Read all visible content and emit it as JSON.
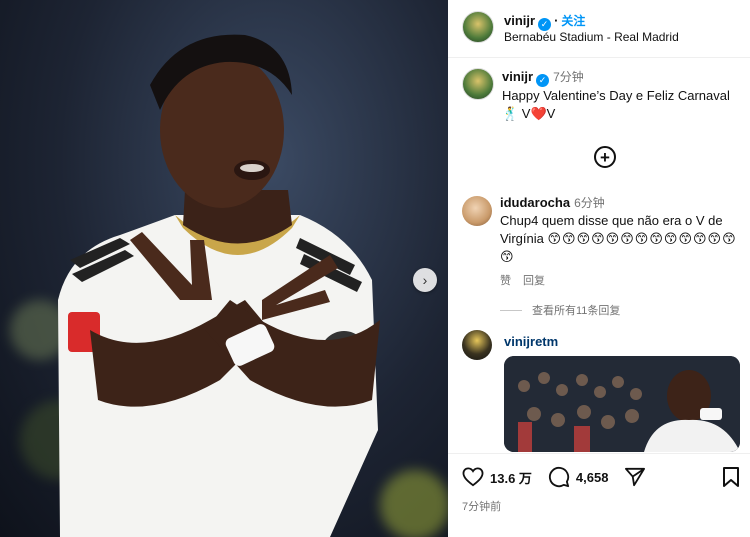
{
  "header": {
    "username": "vinijr",
    "follow_label": "关注",
    "location": "Bernabéu Stadium - Real Madrid"
  },
  "caption": {
    "username": "vinijr",
    "time": "7分钟",
    "text": "Happy Valentine’s Day e Feliz Carnaval 🕺 V❤️V"
  },
  "comment": {
    "username": "idudarocha",
    "time": "6分钟",
    "text": "Chup4 quem disse que não era o V de Virgínia",
    "emojis": "😙😙😙😙😙😙😙😙😙😙😙😙😙😙",
    "like_label": "赞",
    "reply_label": "回复",
    "view_replies": "查看所有11条回复"
  },
  "reply": {
    "username": "vinijretm"
  },
  "footer": {
    "likes": "13.6 万",
    "comments": "4,658",
    "posted": "7分钟前"
  },
  "colors": {
    "accent": "#0095f6",
    "muted": "#737373",
    "link": "#00376b"
  }
}
